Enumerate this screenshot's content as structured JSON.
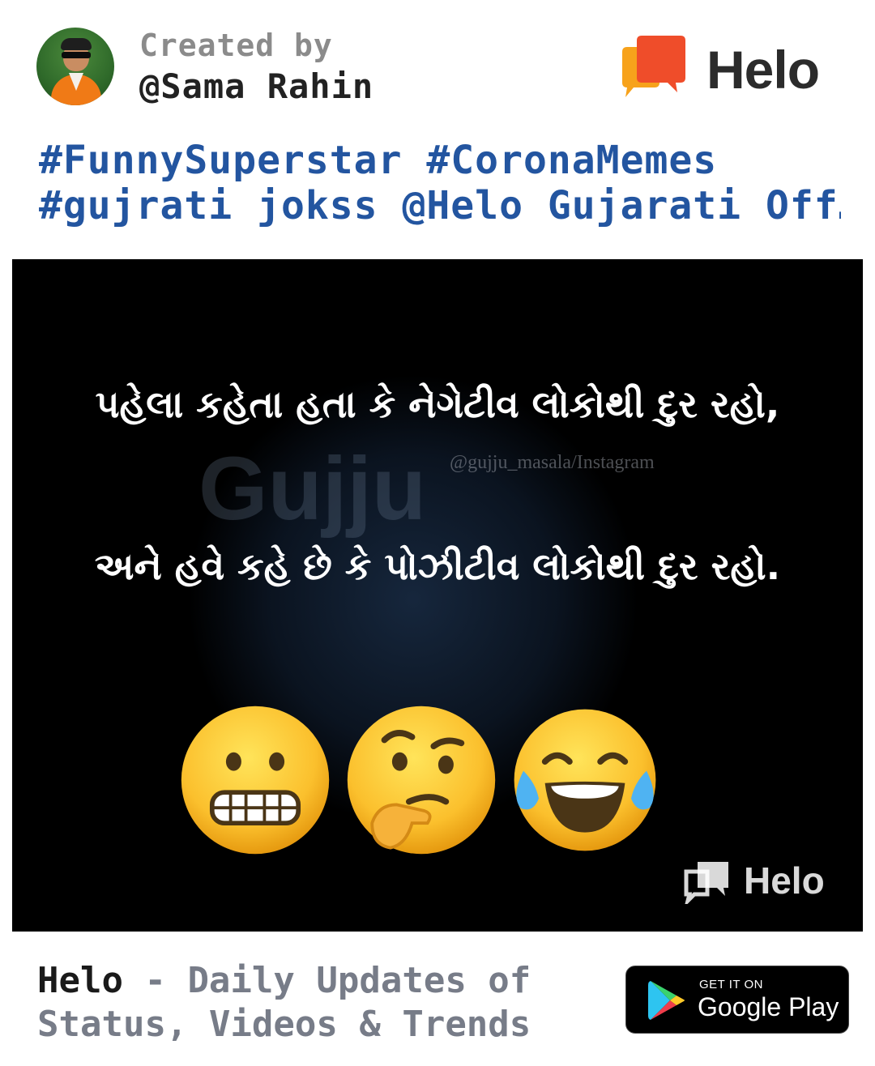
{
  "header": {
    "created_label": "Created by",
    "username": "@Sama Rahin",
    "brand": "Helo",
    "hashtags_line1": "#FunnySuperstar #CoronaMemes",
    "hashtags_line2": "#gujrati jokss @Helo Gujarati Off…"
  },
  "post": {
    "line1": "પહેલા કહેતા હતા કે નેગેટીવ લોકોથી દુર રહો,",
    "line2": "અને હવે કહે છે કે પોઝીટીવ લોકોથી દુર રહો.",
    "watermark_big": "Gujju",
    "watermark_handle": "@gujju_masala/Instagram",
    "watermark_brand": "Helo",
    "emojis": [
      "grimacing-face",
      "thinking-face",
      "face-with-tears-of-joy"
    ]
  },
  "footer": {
    "brand": "Helo",
    "tagline_part1": " - Daily Updates of",
    "tagline_line2": "Status, Videos & Trends",
    "badge_small": "GET IT ON",
    "badge_large": "Google Play"
  },
  "colors": {
    "hashtag": "#2355a0",
    "logo_orange": "#f58a1f",
    "logo_red": "#e8412c"
  }
}
